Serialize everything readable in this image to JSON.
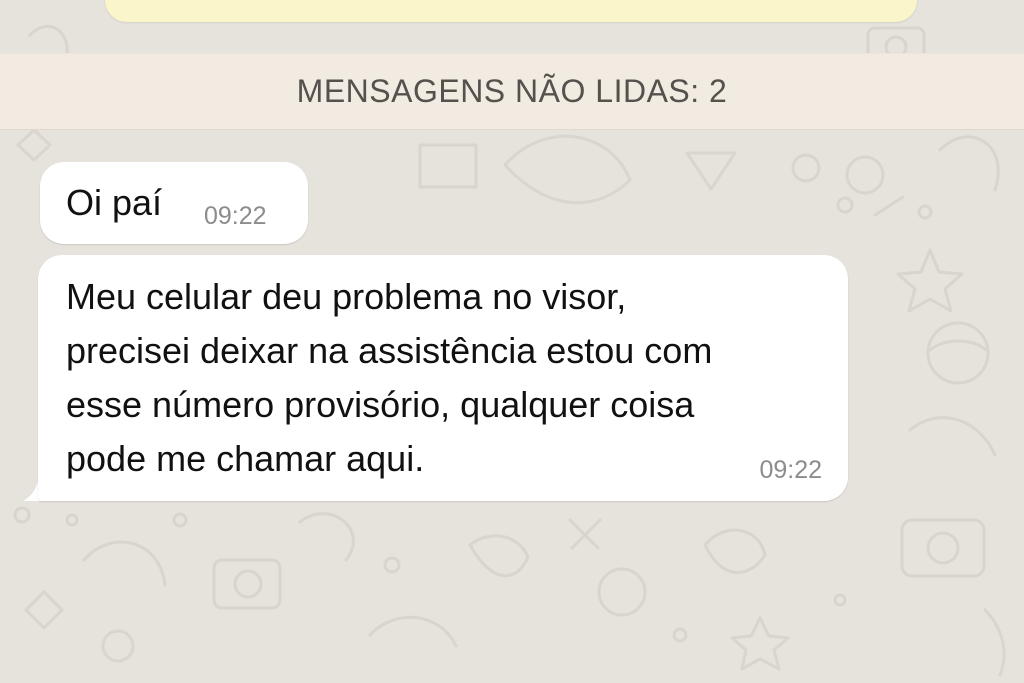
{
  "chat": {
    "unread_banner": "MENSAGENS NÃO LIDAS: 2",
    "messages": [
      {
        "text_lines": [
          "Oi paí"
        ],
        "time": "09:22"
      },
      {
        "text_lines": [
          "Meu celular deu problema no visor,",
          "precisei deixar na assistência estou com",
          "esse número provisório, qualquer coisa",
          "pode me chamar aqui."
        ],
        "time": "09:22"
      }
    ]
  },
  "colors": {
    "wallpaper": "#e6e2dc",
    "banner": "#f1ebe2",
    "bubble": "#ffffff",
    "quoted_bubble": "#fbf6c9",
    "timestamp": "#8c8c8c"
  },
  "icons": [
    "doodle-wallpaper-pattern"
  ]
}
